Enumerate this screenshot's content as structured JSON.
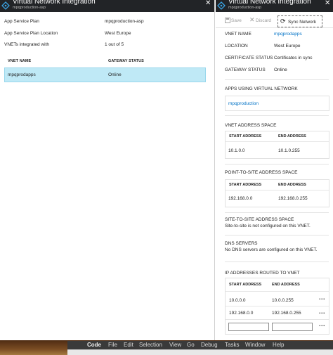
{
  "left_blade": {
    "title": "Virtual Network Integration",
    "subtitle": "mpqproduction-asp",
    "close_glyph": "✕",
    "rows": [
      {
        "label": "App Service Plan",
        "value": "mpqproduction-asp"
      },
      {
        "label": "App Service Plan Location",
        "value": "West Europe"
      },
      {
        "label": "VNETs integrated with",
        "value": "1 out of 5"
      }
    ],
    "table": {
      "columns": [
        "VNET NAME",
        "GATEWAY STATUS"
      ],
      "rows": [
        {
          "name": "mpqprodapps",
          "status": "Online"
        }
      ]
    }
  },
  "right_blade": {
    "title": "Virtual Network Integration",
    "subtitle": "mpqproduction-asp",
    "close_glyph": "✕",
    "toolbar": {
      "save": "Save",
      "discard": "Discard",
      "sync": "Sync Network",
      "save_icon": "save-icon",
      "discard_icon": "discard-icon",
      "sync_icon": "refresh-icon"
    },
    "details": [
      {
        "label": "VNET NAME",
        "value": "mpqprodapps"
      },
      {
        "label": "LOCATION",
        "value": "West Europe"
      },
      {
        "label": "CERTIFICATE STATUS",
        "value": "Certificates in sync"
      },
      {
        "label": "GATEWAY STATUS",
        "value": "Online"
      }
    ],
    "apps_section": {
      "title": "APPS USING VIRTUAL NETWORK",
      "apps": [
        "mpqproduction"
      ]
    },
    "vnet_address_space": {
      "title": "VNET ADDRESS SPACE",
      "columns": [
        "START ADDRESS",
        "END ADDRESS"
      ],
      "rows": [
        {
          "start": "10.1.0.0",
          "end": "10.1.0.255"
        }
      ]
    },
    "p2s_address_space": {
      "title": "POINT-TO-SITE ADDRESS SPACE",
      "columns": [
        "START ADDRESS",
        "END ADDRESS"
      ],
      "rows": [
        {
          "start": "192.168.0.0",
          "end": "192.168.0.255"
        }
      ]
    },
    "s2s_address_space": {
      "title": "SITE-TO-SITE ADDRESS SPACE",
      "message": "Site-to-site is not configured on this VNET."
    },
    "dns_servers": {
      "title": "DNS SERVERS",
      "message": "No DNS servers are configured on this VNET."
    },
    "ip_routes": {
      "title": "IP ADDRESSES ROUTED TO VNET",
      "columns": [
        "START ADDRESS",
        "END ADDRESS"
      ],
      "rows": [
        {
          "start": "10.0.0.0",
          "end": "10.0.0.255",
          "more": "..."
        },
        {
          "start": "192.168.0.0",
          "end": "192.168.0.255",
          "more": "..."
        }
      ],
      "new_row": {
        "start_value": "",
        "end_value": "",
        "more": "..."
      }
    }
  },
  "menubar": {
    "apple_glyph": "",
    "app": "Code",
    "items": [
      "File",
      "Edit",
      "Selection",
      "View",
      "Go",
      "Debug",
      "Tasks",
      "Window",
      "Help"
    ]
  },
  "colors": {
    "header_bg": "#222427",
    "link_blue": "#0072c6",
    "selected_row": "#bfe9f6"
  }
}
